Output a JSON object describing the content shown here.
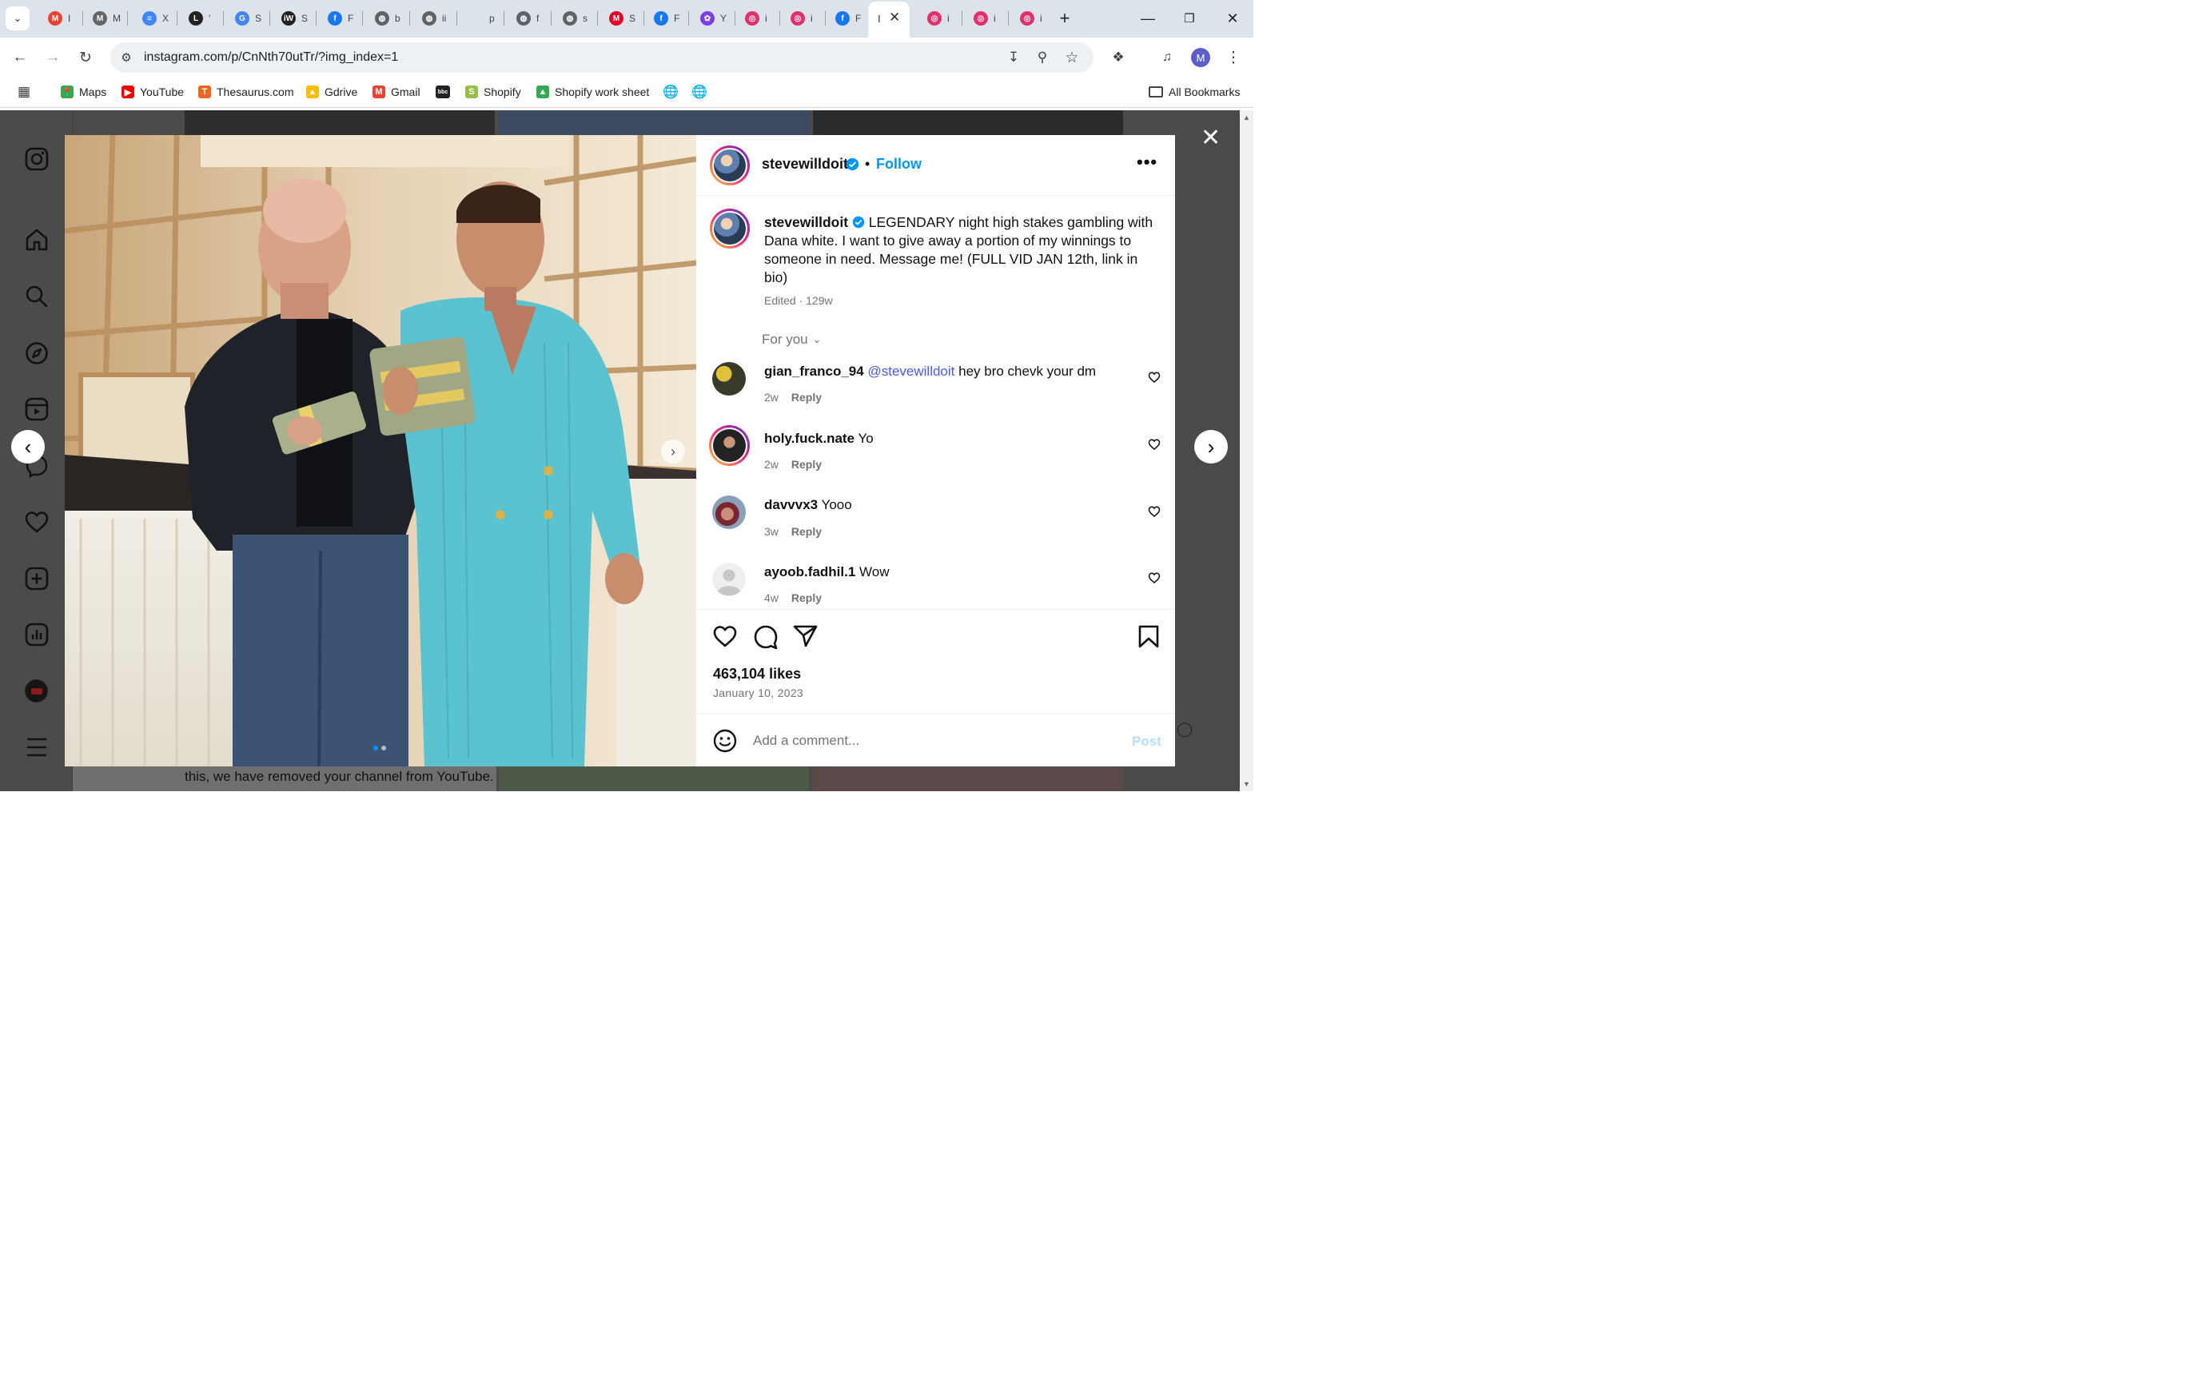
{
  "browser": {
    "tabs": [
      {
        "icon": "gmail-icon",
        "title": "I",
        "color": "#ea4335",
        "glyph": "M"
      },
      {
        "icon": "generic-icon",
        "title": "M",
        "color": "#666666",
        "glyph": "M"
      },
      {
        "icon": "docs-icon",
        "title": "X",
        "color": "#4285f4",
        "glyph": "≡"
      },
      {
        "icon": "l-icon",
        "title": "'",
        "color": "#222222",
        "glyph": "L"
      },
      {
        "icon": "google-icon",
        "title": "S",
        "color": "#4285f4",
        "glyph": "G"
      },
      {
        "icon": "iw-icon",
        "title": "S",
        "color": "#222222",
        "glyph": "iW"
      },
      {
        "icon": "facebook-icon",
        "title": "F",
        "color": "#1877f2",
        "glyph": "f"
      },
      {
        "icon": "globe-icon",
        "title": "b",
        "color": "#5f6368",
        "glyph": "◍"
      },
      {
        "icon": "globe-icon",
        "title": "ii",
        "color": "#5f6368",
        "glyph": "◍"
      },
      {
        "icon": "blank-icon",
        "title": "p",
        "color": "#dde3ea",
        "glyph": ""
      },
      {
        "icon": "globe-icon",
        "title": "f",
        "color": "#5f6368",
        "glyph": "◍"
      },
      {
        "icon": "globe-icon",
        "title": "s",
        "color": "#5f6368",
        "glyph": "◍"
      },
      {
        "icon": "m-icon",
        "title": "S",
        "color": "#e4002b",
        "glyph": "M"
      },
      {
        "icon": "facebook-icon",
        "title": "F",
        "color": "#1877f2",
        "glyph": "f"
      },
      {
        "icon": "butterfly-icon",
        "title": "Y",
        "color": "#7b3fe4",
        "glyph": "✿"
      },
      {
        "icon": "instagram-icon",
        "title": "i",
        "color": "#e1306c",
        "glyph": "◎"
      },
      {
        "icon": "instagram-icon",
        "title": "i",
        "color": "#e1306c",
        "glyph": "◎"
      },
      {
        "icon": "facebook-icon",
        "title": "F",
        "color": "#1877f2",
        "glyph": "f"
      },
      {
        "icon": "active-tab",
        "title": "I",
        "color": "#ffffff",
        "glyph": ""
      },
      {
        "icon": "instagram-icon",
        "title": "i",
        "color": "#e1306c",
        "glyph": "◎"
      },
      {
        "icon": "instagram-icon",
        "title": "i",
        "color": "#e1306c",
        "glyph": "◎"
      },
      {
        "icon": "instagram-icon",
        "title": "i",
        "color": "#e1306c",
        "glyph": "◎"
      }
    ],
    "url": "instagram.com/p/CnNth70utTr/?img_index=1",
    "profile_initial": "M",
    "bookmarks": [
      {
        "label": "Maps",
        "icon": "maps-icon",
        "color": "#34a853"
      },
      {
        "label": "YouTube",
        "icon": "youtube-icon",
        "color": "#ff0000"
      },
      {
        "label": "Thesaurus.com",
        "icon": "thesaurus-icon",
        "color": "#f26522"
      },
      {
        "label": "Gdrive",
        "icon": "drive-icon",
        "color": "#fbbc04"
      },
      {
        "label": "Gmail",
        "icon": "gmail-icon",
        "color": "#ea4335"
      },
      {
        "label": "",
        "icon": "bbc-icon",
        "color": "#222222"
      },
      {
        "label": "Shopify",
        "icon": "shopify-icon",
        "color": "#95bf47"
      },
      {
        "label": "Shopify work sheet",
        "icon": "drive-icon",
        "color": "#34a853"
      }
    ],
    "all_bookmarks": "All Bookmarks"
  },
  "background": {
    "caption": "this, we have removed your channel from YouTube."
  },
  "post": {
    "username": "stevewilldoit",
    "follow": "Follow",
    "caption": "LEGENDARY night high stakes gambling with Dana white. I want to give away a portion of my winnings to someone in need. Message me! (FULL VID JAN 12th, link in bio)",
    "edited": "Edited · 129w",
    "for_you": "For you",
    "comments": [
      {
        "user": "gian_franco_94",
        "mention": "@stevewilldoit",
        "text": "hey bro chevk your dm",
        "age": "2w",
        "reply": "Reply"
      },
      {
        "user": "holy.fuck.nate",
        "mention": "",
        "text": "Yo",
        "age": "2w",
        "reply": "Reply"
      },
      {
        "user": "davvvx3",
        "mention": "",
        "text": "Yooo",
        "age": "3w",
        "reply": "Reply"
      },
      {
        "user": "ayoob.fadhil.1",
        "mention": "",
        "text": "Wow",
        "age": "4w",
        "reply": "Reply"
      }
    ],
    "likes": "463,104 likes",
    "date": "January 10, 2023",
    "add_comment_placeholder": "Add a comment...",
    "post_button": "Post",
    "carousel": {
      "current": 1,
      "total": 2
    }
  },
  "colors": {
    "accent": "#0095f6",
    "mention": "#4a5af0",
    "verified": "#0095f6"
  }
}
